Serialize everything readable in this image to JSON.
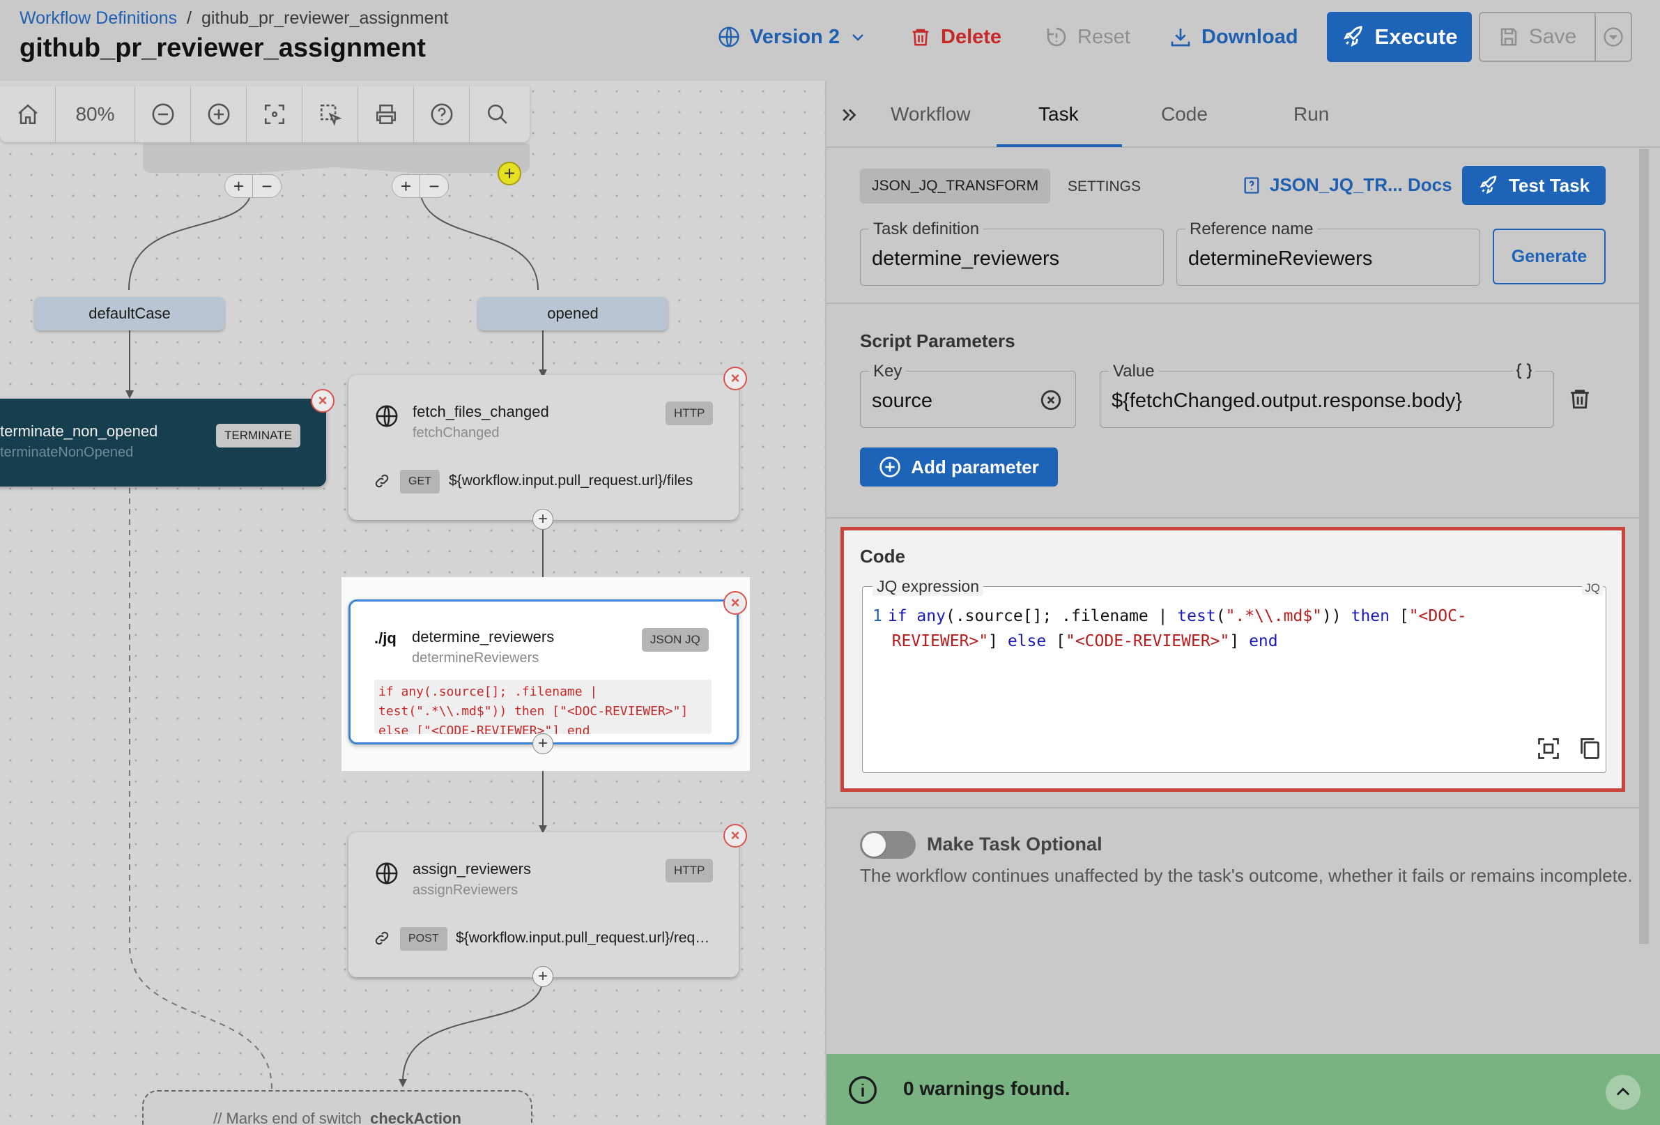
{
  "breadcrumb": {
    "parent": "Workflow Definitions",
    "separator": "/",
    "current": "github_pr_reviewer_assignment"
  },
  "page_title": "github_pr_reviewer_assignment",
  "header_actions": {
    "version": "Version 2",
    "delete": "Delete",
    "reset": "Reset",
    "download": "Download",
    "execute": "Execute",
    "save": "Save"
  },
  "canvas": {
    "zoom": "80%",
    "cases": {
      "default": "defaultCase",
      "opened": "opened"
    },
    "nodes": {
      "terminate": {
        "name": "terminate_non_opened",
        "ref": "terminateNonOpened",
        "type": "TERMINATE"
      },
      "fetch": {
        "name": "fetch_files_changed",
        "ref": "fetchChanged",
        "type": "HTTP",
        "method": "GET",
        "url": "${workflow.input.pull_request.url}/files"
      },
      "jq": {
        "prefix": "./jq",
        "name": "determine_reviewers",
        "ref": "determineReviewers",
        "type": "JSON JQ",
        "snippet": "if any(.source[]; .filename | test(\".*\\\\.md$\")) then [\"<DOC-REVIEWER>\"] else [\"<CODE-REVIEWER>\"] end"
      },
      "assign": {
        "name": "assign_reviewers",
        "ref": "assignReviewers",
        "type": "HTTP",
        "method": "POST",
        "url": "${workflow.input.pull_request.url}/requested_reviewers"
      }
    },
    "end_node": {
      "comment": "// Marks end of switch",
      "name": "checkAction"
    }
  },
  "panel": {
    "tabs": [
      "Workflow",
      "Task",
      "Code",
      "Run"
    ],
    "active_tab": "Task",
    "task_type_chip": "JSON_JQ_TRANSFORM",
    "settings_tab": "SETTINGS",
    "docs_link": "JSON_JQ_TR... Docs",
    "test_task": "Test Task",
    "task_definition": {
      "label": "Task definition",
      "value": "determine_reviewers"
    },
    "reference_name": {
      "label": "Reference name",
      "value": "determineReviewers"
    },
    "generate": "Generate",
    "script_params": {
      "title": "Script Parameters",
      "key_label": "Key",
      "key_value": "source",
      "value_label": "Value",
      "value_value": "${fetchChanged.output.response.body}",
      "add_parameter": "Add parameter"
    },
    "code": {
      "title": "Code",
      "expression_label": "JQ expression",
      "lang": "JQ",
      "line_number": "1"
    },
    "optional": {
      "title": "Make Task Optional",
      "description": "The workflow continues unaffected by the task's outcome, whether it fails or remains incomplete."
    },
    "warnings": "0 warnings found."
  }
}
